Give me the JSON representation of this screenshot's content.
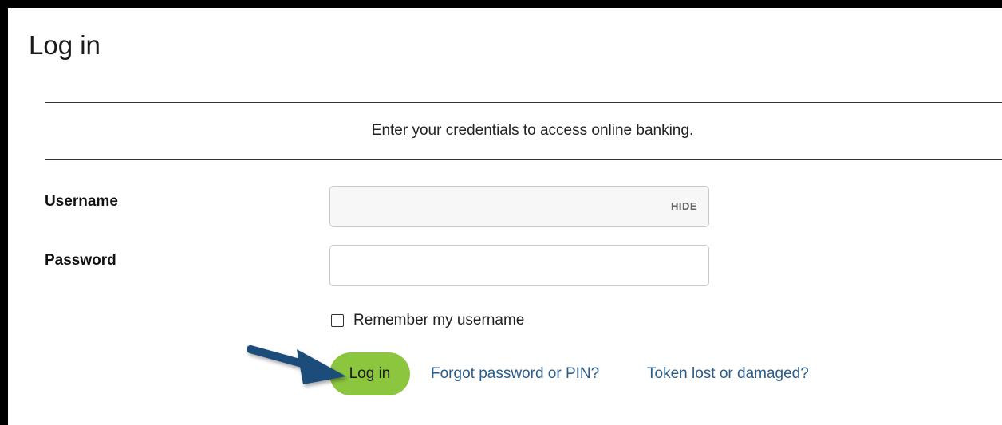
{
  "page": {
    "title": "Log in",
    "intro": "Enter your credentials to access online banking."
  },
  "form": {
    "username_label": "Username",
    "username_value": "",
    "username_toggle": "HIDE",
    "password_label": "Password",
    "password_value": "",
    "remember_label": "Remember my username",
    "remember_checked": false,
    "login_label": "Log in"
  },
  "links": {
    "forgot": "Forgot password or PIN?",
    "token": "Token lost or damaged?"
  },
  "colors": {
    "login_button": "#8cc63f",
    "link": "#2a5d8a",
    "arrow": "#1f4e7a"
  },
  "annotation": {
    "icon": "arrow-right-icon"
  }
}
